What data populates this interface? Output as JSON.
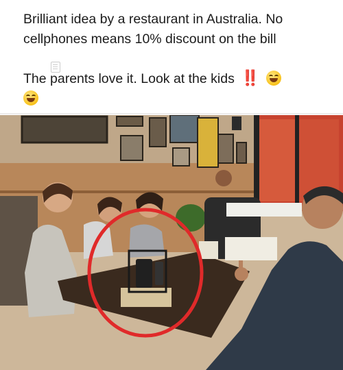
{
  "post": {
    "text_line1": "Brilliant idea by a restaurant in Australia. No cellphones means 10% discount on the bill",
    "text_line2": "The parents love it. Look at the kids",
    "exclamation": "‼️",
    "emoji": "grinning-smiling-eyes-emoji"
  },
  "photo": {
    "subject": "restaurant-table-with-phone-basket",
    "colors": {
      "wall": "#cdb79a",
      "table": "#3a2a1e",
      "circle": "#e02a2a",
      "window": "#c7432f"
    }
  }
}
